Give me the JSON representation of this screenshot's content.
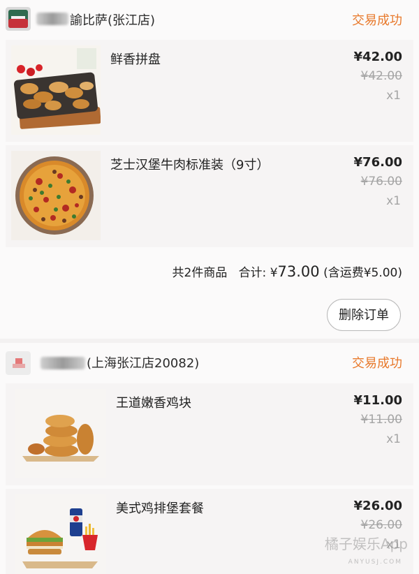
{
  "orders": [
    {
      "shop": {
        "name": "諭比萨(张江店)",
        "logo_icon": "pizza-shop-logo-icon"
      },
      "status": "交易成功",
      "items": [
        {
          "name": "鲜香拼盘",
          "price": "¥42.00",
          "original_price": "¥42.00",
          "qty": "x1",
          "image_icon": "fried-platter-image"
        },
        {
          "name": "芝士汉堡牛肉标准装（9寸）",
          "price": "¥76.00",
          "original_price": "¥76.00",
          "qty": "x1",
          "image_icon": "pizza-image"
        }
      ],
      "summary": {
        "count_text": "共2件商品",
        "total_label": "合计:",
        "currency": "¥",
        "total": "73.00",
        "shipping_note": "(含运费¥5.00)"
      },
      "delete_label": "删除订单"
    },
    {
      "shop": {
        "name": "(上海张江店20082)",
        "logo_icon": "burger-shop-logo-icon"
      },
      "status": "交易成功",
      "items": [
        {
          "name": "王道嫩香鸡块",
          "price": "¥11.00",
          "original_price": "¥11.00",
          "qty": "x1",
          "image_icon": "chicken-nuggets-image"
        },
        {
          "name": "美式鸡排堡套餐",
          "price": "¥26.00",
          "original_price": "¥26.00",
          "qty": "x1",
          "image_icon": "burger-combo-image"
        }
      ]
    }
  ],
  "watermark": {
    "text": "橘子娱乐App",
    "sub": "ANYUSJ.COM"
  },
  "colors": {
    "status": "#e8792b",
    "strike": "#a5a5a5",
    "background": "#f3f1f1"
  }
}
